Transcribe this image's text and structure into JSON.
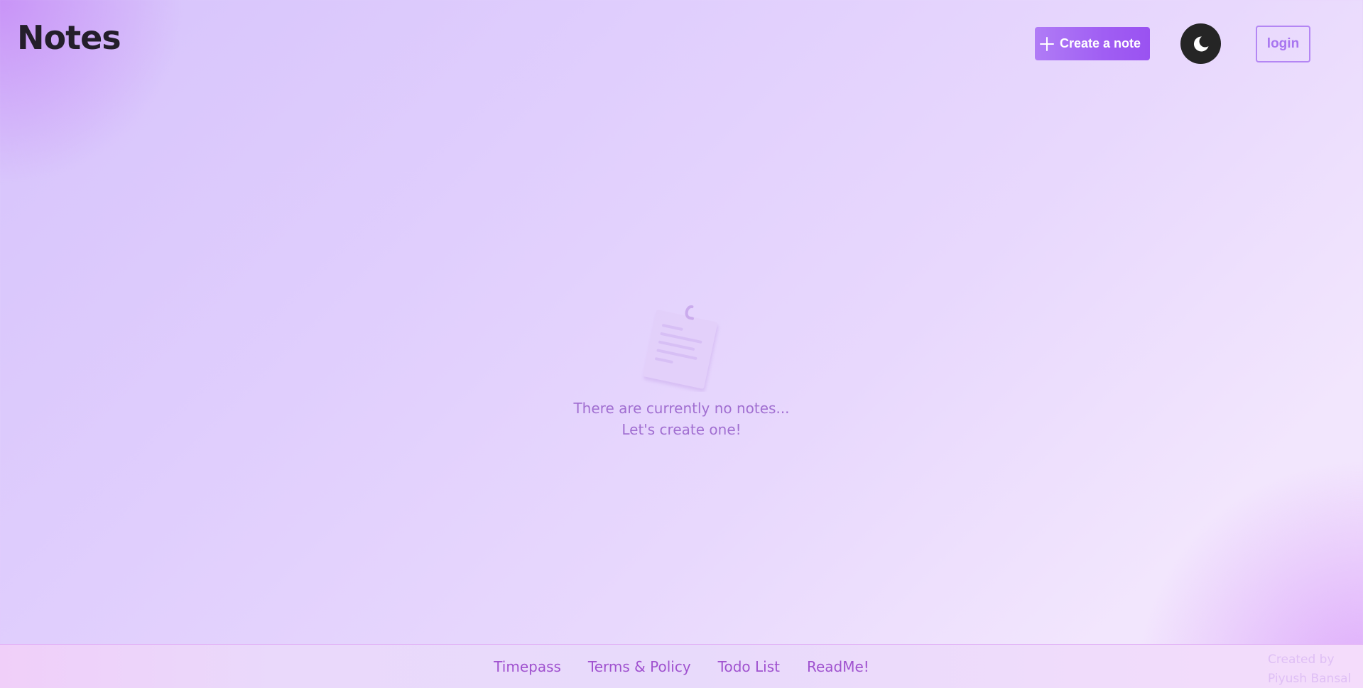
{
  "header": {
    "title": "Notes",
    "create_button_label": "Create a note",
    "create_button_icon": "plus-icon",
    "theme_toggle_icon": "moon-icon",
    "login_label": "login"
  },
  "empty_state": {
    "illustration_icon": "sticky-note-icon",
    "line1": "There are currently no notes...",
    "line2": "Let's create one!"
  },
  "footer": {
    "links": [
      "Timepass",
      "Terms & Policy",
      "Todo List",
      "ReadMe!"
    ],
    "credit_line1": "Created by",
    "credit_line2": "Piyush Bansal"
  },
  "colors": {
    "accent": "#a05ef3",
    "title_text": "#241f2b",
    "toggle_background": "#252525",
    "empty_text": "#a16fd1",
    "footer_link": "#a052cf"
  }
}
